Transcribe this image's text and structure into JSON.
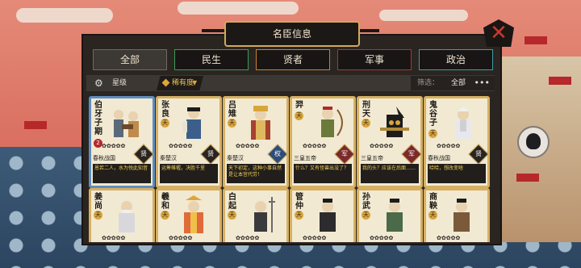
{
  "window": {
    "title": "名臣信息"
  },
  "tabs": [
    {
      "label": "全部",
      "color": "#6f6a64",
      "active": true
    },
    {
      "label": "民生",
      "color": "#3c9b55"
    },
    {
      "label": "贤者",
      "color": "#c9822e"
    },
    {
      "label": "军事",
      "color": "#b2332e"
    },
    {
      "label": "政治",
      "color": "#3b9ea3"
    }
  ],
  "filter": {
    "star_label": "星级",
    "sort_label": "稀有度",
    "right_label": "筛选：",
    "right_value": "全部"
  },
  "cards": [
    {
      "name": "伯牙子期",
      "badge": "2",
      "stars": "✿✿✿✿✿",
      "dynasty": "春秋战国",
      "trait": "贤",
      "quote": "恩若二人，水为悦此知音",
      "selected": true
    },
    {
      "name": "张良",
      "tag": "天",
      "stars": "✿✿✿✿✿",
      "dynasty": "秦楚汉",
      "trait": "贤",
      "quote": "运筹帷幄，决胜千里"
    },
    {
      "name": "吕雉",
      "tag": "天",
      "stars": "✿✿✿✿✿",
      "dynasty": "秦楚汉",
      "trait": "权",
      "quote": "天下初定，这种小事自然是让本宫代劳！"
    },
    {
      "name": "羿",
      "tag": "天",
      "stars": "✿✿✿✿✿",
      "dynasty": "三皇五帝",
      "trait": "军",
      "quote": "什么？又有怪兽出没了？"
    },
    {
      "name": "刑天",
      "tag": "天",
      "stars": "✿✿✿✿✿",
      "dynasty": "三皇五帝",
      "trait": "军",
      "quote": "我的头？应该在后面……"
    },
    {
      "name": "鬼谷子",
      "tag": "天",
      "stars": "✿✿✿✿✿",
      "dynasty": "春秋战国",
      "trait": "贤",
      "quote": "哈哈，想改变啥"
    },
    {
      "name": "姜尚",
      "tag": "天",
      "stars": "✿✿✿✿✿"
    },
    {
      "name": "羲和",
      "tag": "天",
      "stars": "✿✿✿✿✿"
    },
    {
      "name": "白起",
      "tag": "天",
      "stars": "✿✿✿✿✿"
    },
    {
      "name": "管仲",
      "tag": "天",
      "stars": "✿✿✿✿✿"
    },
    {
      "name": "孙武",
      "tag": "天",
      "stars": "✿✿✿✿✿"
    },
    {
      "name": "商鞅",
      "tag": "天",
      "stars": "✿✿✿✿✿"
    }
  ]
}
